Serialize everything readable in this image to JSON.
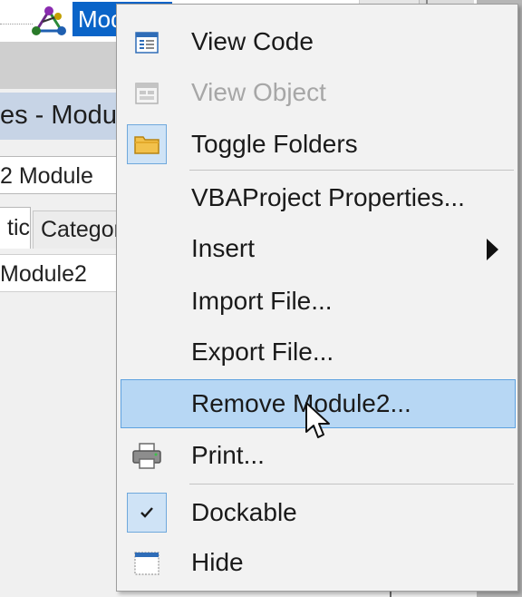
{
  "background": {
    "tree_node_label": "Mod",
    "properties_title": "es - Modu",
    "object_combo_value": "2 Module",
    "tab_alphabetic": "tic",
    "tab_categorized": "Categor",
    "name_value": "Module2"
  },
  "menu": {
    "items": [
      {
        "label": "View Code",
        "icon": "view-code-icon",
        "enabled": true
      },
      {
        "label": "View Object",
        "icon": "view-object-icon",
        "enabled": false
      },
      {
        "label": "Toggle Folders",
        "icon": "folder-icon",
        "enabled": true,
        "checked_frame": true
      },
      {
        "label": "VBAProject Properties...",
        "enabled": true
      },
      {
        "label": "Insert",
        "enabled": true,
        "submenu": true
      },
      {
        "label": "Import File...",
        "enabled": true
      },
      {
        "label": "Export File...",
        "enabled": true
      },
      {
        "label": "Remove Module2...",
        "enabled": true,
        "highlighted": true
      },
      {
        "label": "Print...",
        "icon": "printer-icon",
        "enabled": true
      },
      {
        "label": "Dockable",
        "icon": "checkmark-icon",
        "enabled": true,
        "checked": true
      },
      {
        "label": "Hide",
        "icon": "window-icon",
        "enabled": true
      }
    ]
  },
  "colors": {
    "menu_background": "#f2f2f2",
    "highlight_background": "#b7d7f4",
    "highlight_border": "#5ea2e0",
    "selection_blue": "#0a64c8",
    "disabled_text": "#a7a7a7"
  }
}
